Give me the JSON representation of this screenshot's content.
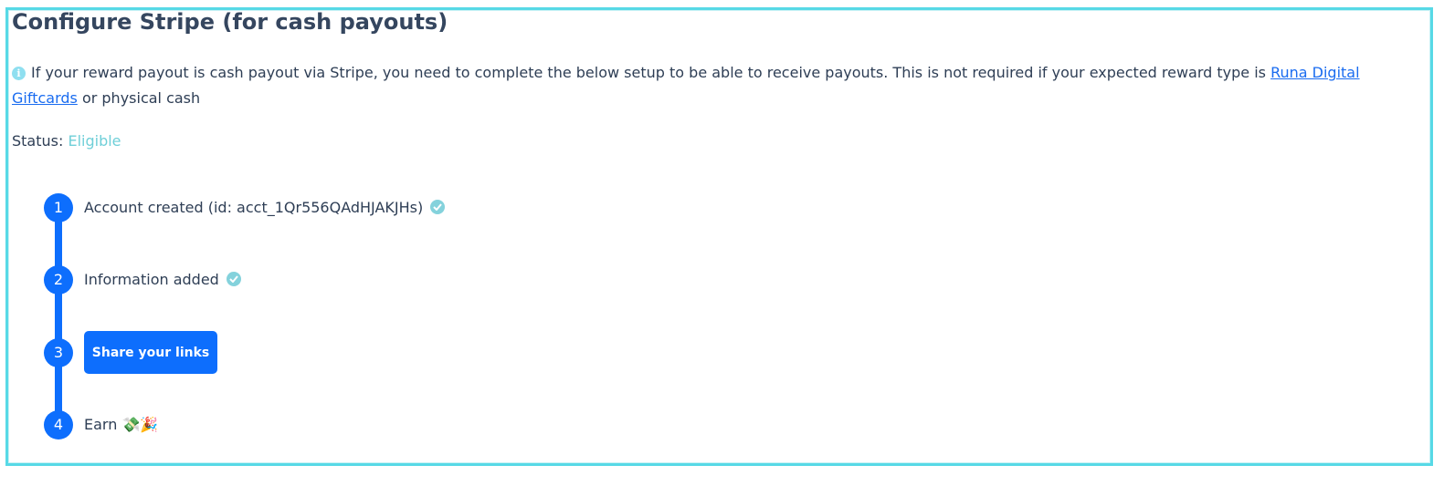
{
  "section": {
    "title": "Configure Stripe (for cash payouts)"
  },
  "info": {
    "icon": "info-icon",
    "text_before": "If your reward payout is cash payout via Stripe, you need to complete the below setup to be able to receive payouts. This is not required if your expected reward type is ",
    "link_text": "Runa Digital Giftcards",
    "text_after": " or physical cash"
  },
  "status": {
    "label": "Status:",
    "value": "Eligible"
  },
  "steps": [
    {
      "number": "1",
      "text": "Account created (id: acct_1Qr556QAdHJAKJHs)",
      "icon": "check-circle-icon"
    },
    {
      "number": "2",
      "text": "Information added",
      "icon": "check-circle-icon"
    },
    {
      "number": "3",
      "button_label": "Share your links"
    },
    {
      "number": "4",
      "text": "Earn",
      "emoji": "💸🎉"
    }
  ],
  "colors": {
    "primary": "#0d6efd",
    "frame_border": "#57d9e6",
    "status_eligible": "#6fcfd8",
    "check": "#84d2dc",
    "link": "#1a6cf0"
  }
}
